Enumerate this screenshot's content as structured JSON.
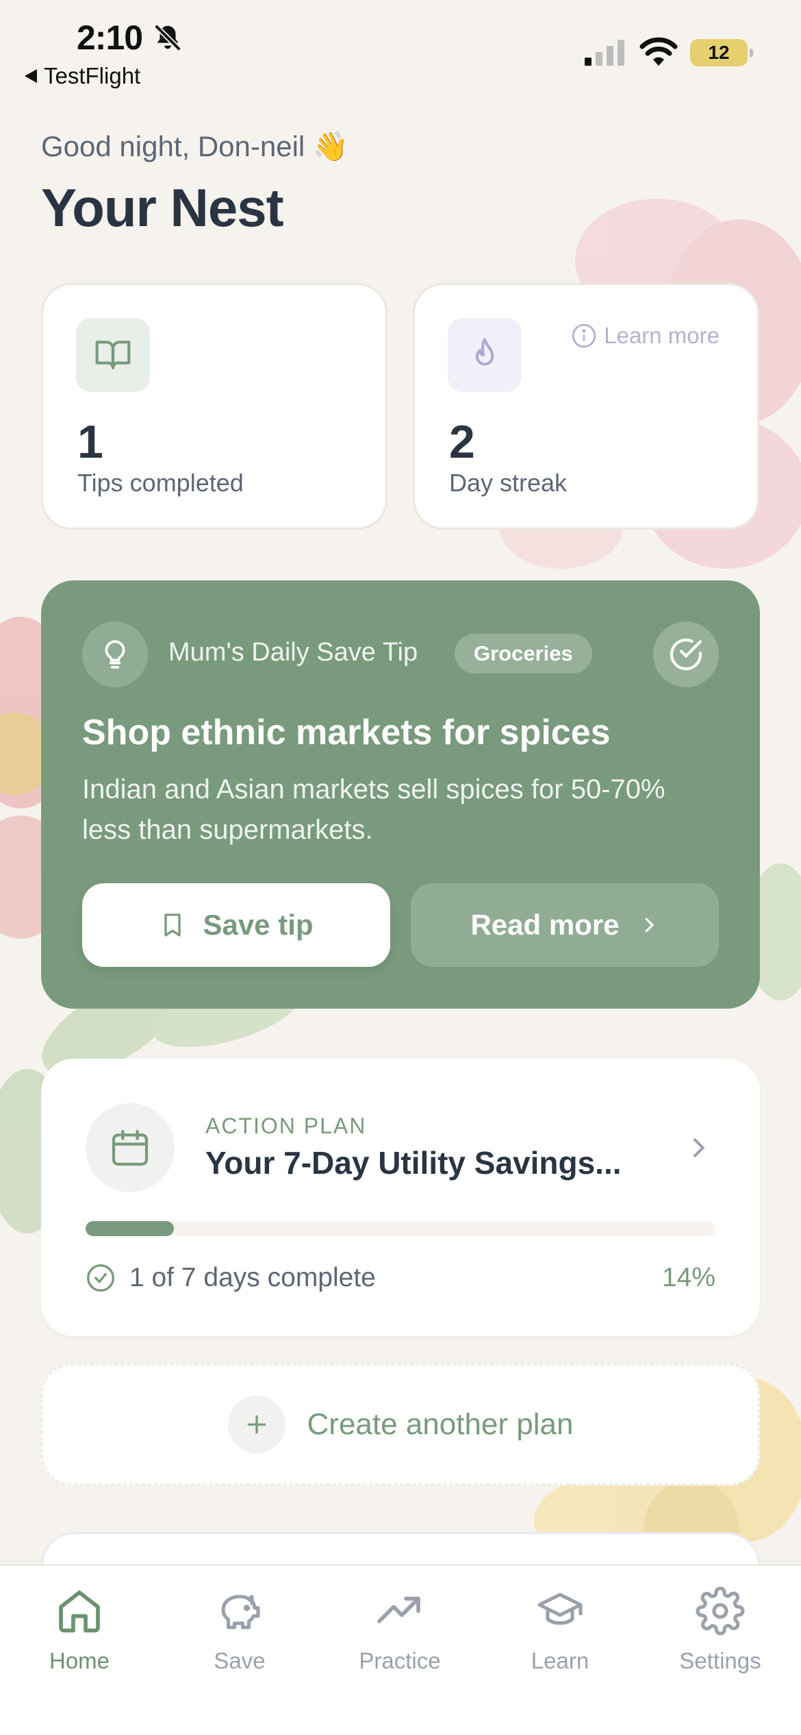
{
  "status_bar": {
    "time": "2:10",
    "back_app": "TestFlight",
    "battery": "12"
  },
  "header": {
    "greeting": "Good night, Don-neil 👋",
    "title": "Your Nest"
  },
  "stats": [
    {
      "value": "1",
      "label": "Tips completed",
      "icon": "book-icon"
    },
    {
      "value": "2",
      "label": "Day streak",
      "icon": "flame-icon",
      "link": "Learn more"
    }
  ],
  "tip": {
    "source": "Mum's Daily Save Tip",
    "tag": "Groceries",
    "title": "Shop ethnic markets for spices",
    "body": "Indian and Asian markets sell spices for 50-70% less than supermarkets.",
    "save_label": "Save tip",
    "read_label": "Read more"
  },
  "action_plan": {
    "eyebrow": "ACTION PLAN",
    "title": "Your 7-Day Utility Savings...",
    "progress": 0.14,
    "status": "1 of 7 days complete",
    "percent": "14%"
  },
  "create_plan_label": "Create another plan",
  "tabs": [
    {
      "label": "Home",
      "icon": "home-icon",
      "active": true
    },
    {
      "label": "Save",
      "icon": "piggy-bank-icon",
      "active": false
    },
    {
      "label": "Practice",
      "icon": "trending-up-icon",
      "active": false
    },
    {
      "label": "Learn",
      "icon": "graduation-cap-icon",
      "active": false
    },
    {
      "label": "Settings",
      "icon": "gear-icon",
      "active": false
    }
  ],
  "colors": {
    "accent": "#799a7d",
    "background": "#f6f3ee",
    "text": "#2b3442",
    "muted": "#5d6674"
  }
}
